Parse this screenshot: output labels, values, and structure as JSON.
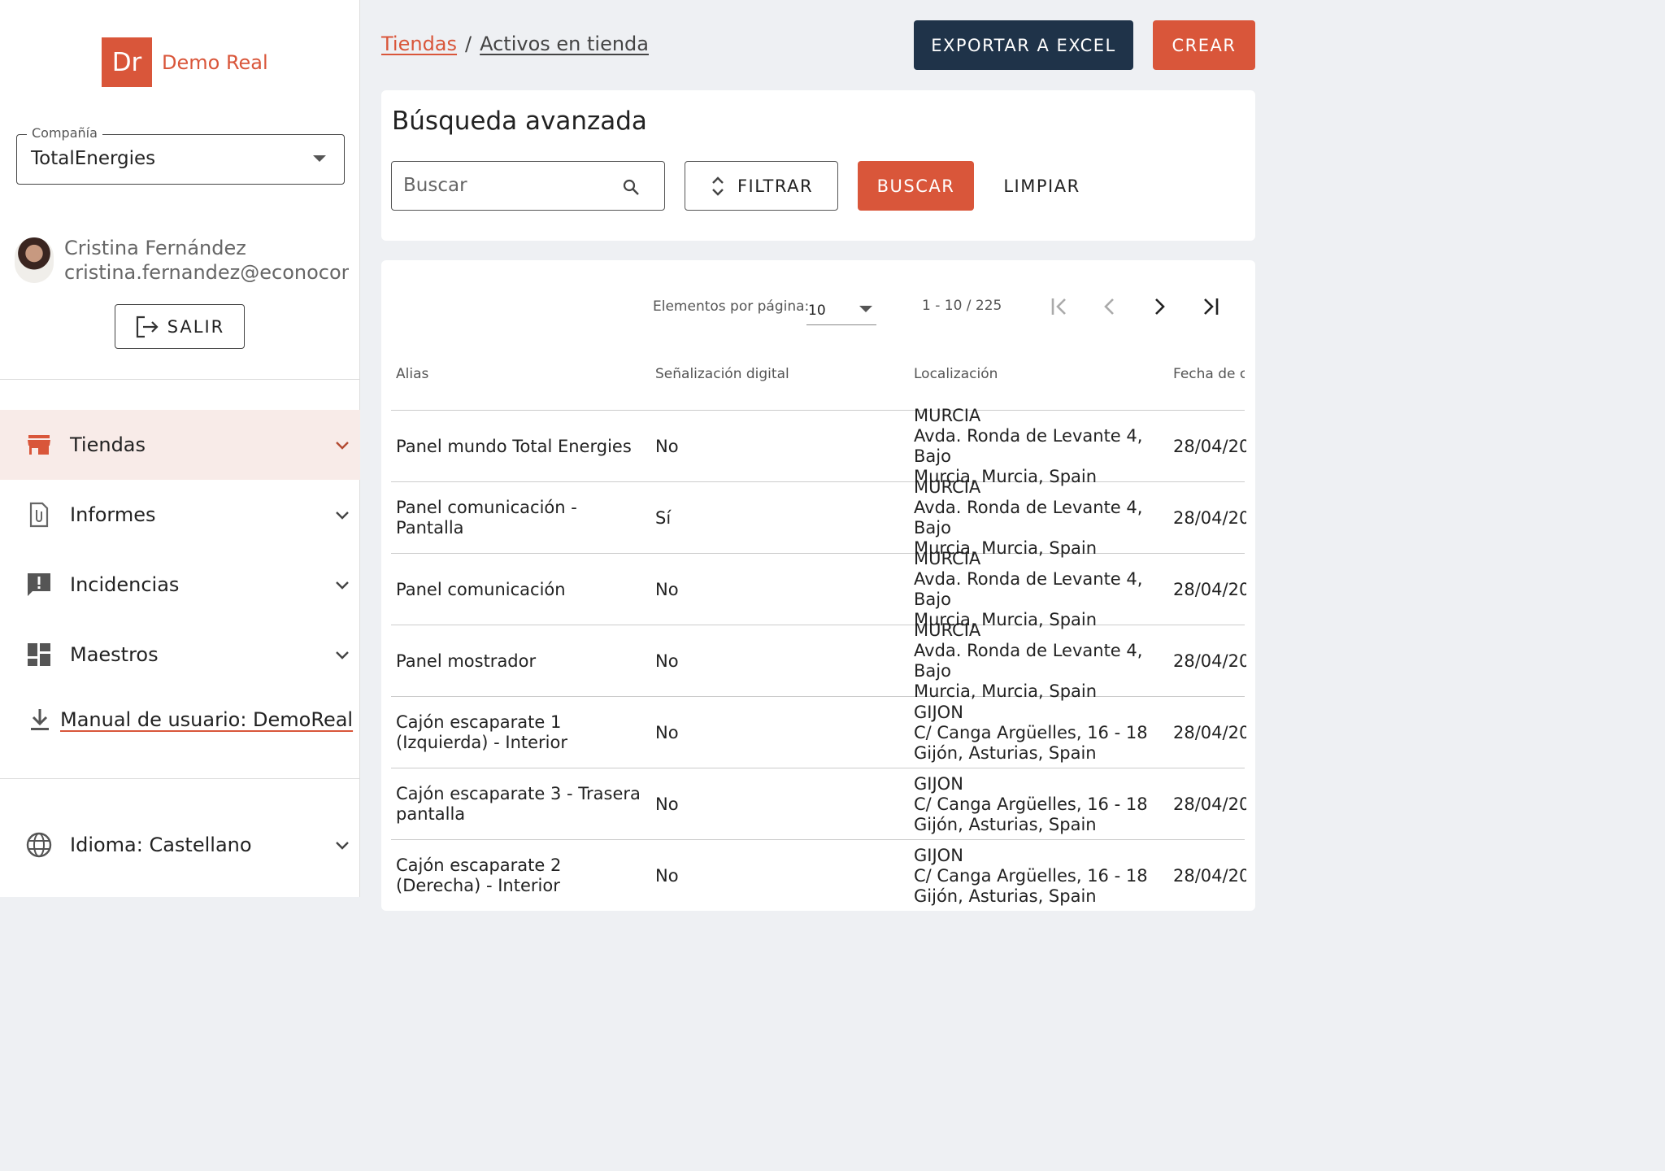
{
  "app": {
    "logo_initials": "Dr",
    "logo_name": "Demo Real",
    "accent_color": "#d9563a",
    "dark_color": "#1f3349"
  },
  "sidebar": {
    "company_label": "Compañía",
    "company_value": "TotalEnergies",
    "user_name": "Cristina Fernández",
    "user_email": "cristina.fernandez@econocom.com",
    "logout_label": "SALIR",
    "nav_items": [
      {
        "label": "Tiendas",
        "icon": "store-icon",
        "active": true
      },
      {
        "label": "Informes",
        "icon": "attachment-file-icon",
        "active": false
      },
      {
        "label": "Incidencias",
        "icon": "feedback-icon",
        "active": false
      },
      {
        "label": "Maestros",
        "icon": "dashboard-icon",
        "active": false
      }
    ],
    "manual_label": "Manual de usuario: DemoReal",
    "language_label": "Idioma: Castellano"
  },
  "header": {
    "breadcrumb_parent": "Tiendas",
    "breadcrumb_separator": "/",
    "breadcrumb_current": "Activos en tienda",
    "export_label": "EXPORTAR A EXCEL",
    "create_label": "CREAR"
  },
  "search": {
    "title": "Búsqueda avanzada",
    "placeholder": "Buscar",
    "filter_label": "FILTRAR",
    "search_label": "BUSCAR",
    "clear_label": "LIMPIAR"
  },
  "pagination": {
    "per_page_label": "Elementos por página:",
    "per_page_value": "10",
    "range": "1 - 10 / 225"
  },
  "table": {
    "columns": [
      "Alias",
      "Señalización digital",
      "Localización",
      "Fecha de cr"
    ],
    "rows": [
      {
        "alias": "Panel mundo Total Energies",
        "digital": "No",
        "loc_city": "MURCIA",
        "loc_address": "Avda. Ronda de Levante 4, Bajo",
        "loc_region": "Murcia, Murcia, Spain",
        "date": "28/04/20"
      },
      {
        "alias": "Panel comunicación - Pantalla",
        "digital": "Sí",
        "loc_city": "MURCIA",
        "loc_address": "Avda. Ronda de Levante 4, Bajo",
        "loc_region": "Murcia, Murcia, Spain",
        "date": "28/04/20"
      },
      {
        "alias": "Panel comunicación",
        "digital": "No",
        "loc_city": "MURCIA",
        "loc_address": "Avda. Ronda de Levante 4, Bajo",
        "loc_region": "Murcia, Murcia, Spain",
        "date": "28/04/20"
      },
      {
        "alias": "Panel mostrador",
        "digital": "No",
        "loc_city": "MURCIA",
        "loc_address": "Avda. Ronda de Levante 4, Bajo",
        "loc_region": "Murcia, Murcia, Spain",
        "date": "28/04/20"
      },
      {
        "alias": "Cajón escaparate 1 (Izquierda) - Interior",
        "digital": "No",
        "loc_city": "GIJON",
        "loc_address": "C/ Canga Argüelles, 16 - 18",
        "loc_region": "Gijón, Asturias, Spain",
        "date": "28/04/20"
      },
      {
        "alias": "Cajón escaparate 3 - Trasera pantalla",
        "digital": "No",
        "loc_city": "GIJON",
        "loc_address": "C/ Canga Argüelles, 16 - 18",
        "loc_region": "Gijón, Asturias, Spain",
        "date": "28/04/20"
      },
      {
        "alias": "Cajón escaparate 2 (Derecha) - Interior",
        "digital": "No",
        "loc_city": "GIJON",
        "loc_address": "C/ Canga Argüelles, 16 - 18",
        "loc_region": "Gijón, Asturias, Spain",
        "date": "28/04/20"
      }
    ]
  }
}
